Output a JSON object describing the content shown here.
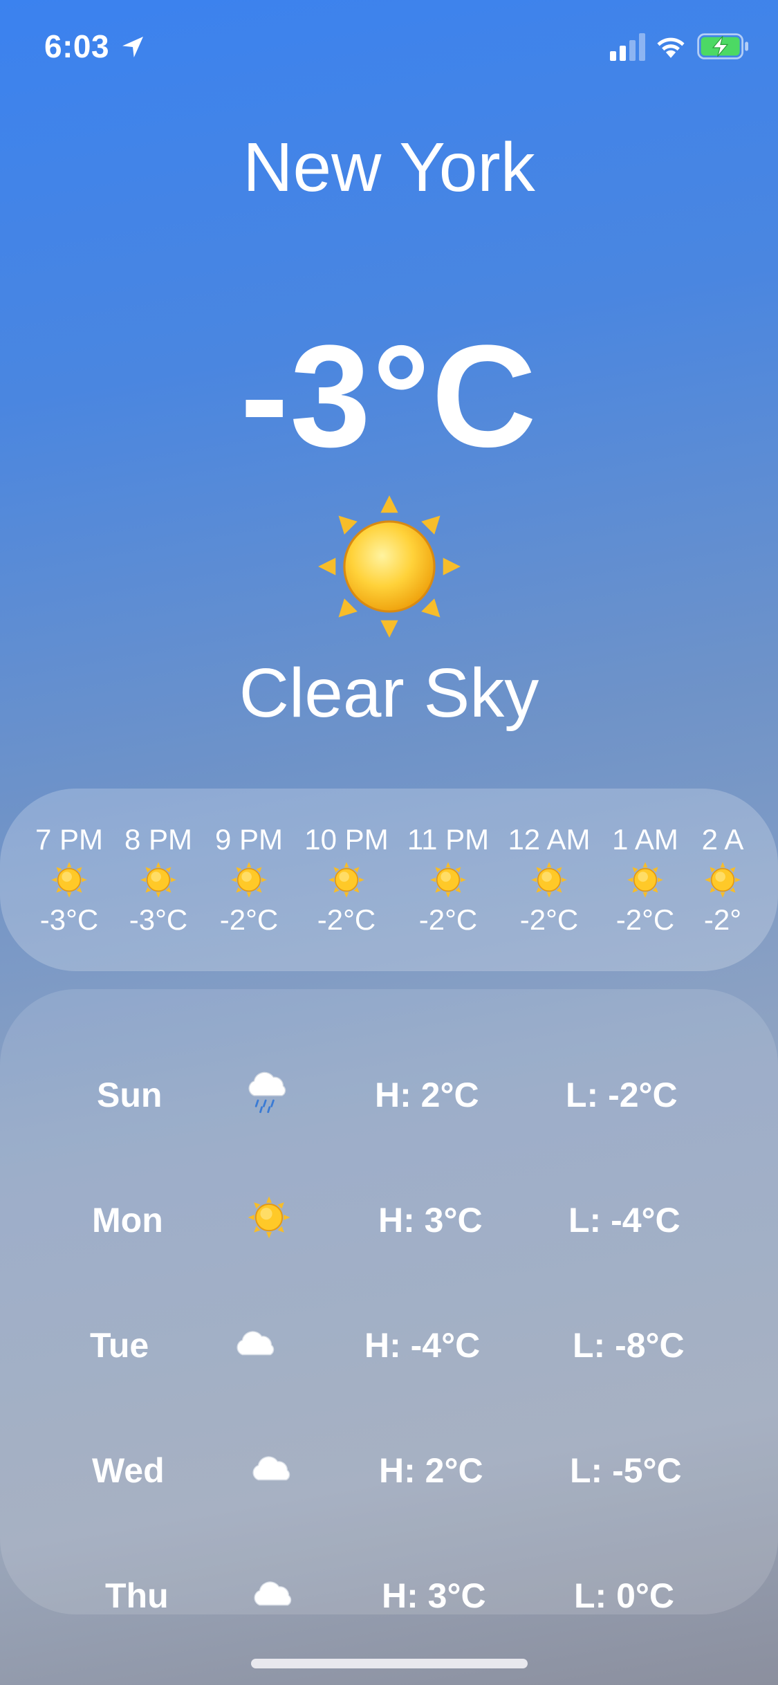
{
  "status_bar": {
    "time": "6:03",
    "location_icon": "location-arrow-icon",
    "signal_icon": "cellular-signal-icon",
    "wifi_icon": "wifi-icon",
    "battery_icon": "battery-charging-icon",
    "battery_color": "#4cd964"
  },
  "current": {
    "city": "New York",
    "temperature": "-3°C",
    "icon": "sun-icon",
    "condition": "Clear Sky"
  },
  "hourly": [
    {
      "time": "7 PM",
      "icon": "sun-icon",
      "temp": "-3°C"
    },
    {
      "time": "8 PM",
      "icon": "sun-icon",
      "temp": "-3°C"
    },
    {
      "time": "9 PM",
      "icon": "sun-icon",
      "temp": "-2°C"
    },
    {
      "time": "10 PM",
      "icon": "sun-icon",
      "temp": "-2°C"
    },
    {
      "time": "11 PM",
      "icon": "sun-icon",
      "temp": "-2°C"
    },
    {
      "time": "12 AM",
      "icon": "sun-icon",
      "temp": "-2°C"
    },
    {
      "time": "1 AM",
      "icon": "sun-icon",
      "temp": "-2°C"
    },
    {
      "time": "2 A",
      "icon": "sun-icon",
      "temp": "-2°"
    }
  ],
  "daily": [
    {
      "day": "Sun",
      "icon": "rain-cloud-icon",
      "high": "H: 2°C",
      "low": "L: -2°C"
    },
    {
      "day": "Mon",
      "icon": "sun-icon",
      "high": "H: 3°C",
      "low": "L: -4°C"
    },
    {
      "day": "Tue",
      "icon": "cloud-icon",
      "high": "H: -4°C",
      "low": "L: -8°C"
    },
    {
      "day": "Wed",
      "icon": "cloud-icon",
      "high": "H: 2°C",
      "low": "L: -5°C"
    },
    {
      "day": "Thu",
      "icon": "cloud-icon",
      "high": "H: 3°C",
      "low": "L: 0°C"
    }
  ],
  "colors": {
    "background_top": "#3b82ef",
    "background_bottom": "#8b8f9e",
    "sun": "#f5b40f"
  }
}
